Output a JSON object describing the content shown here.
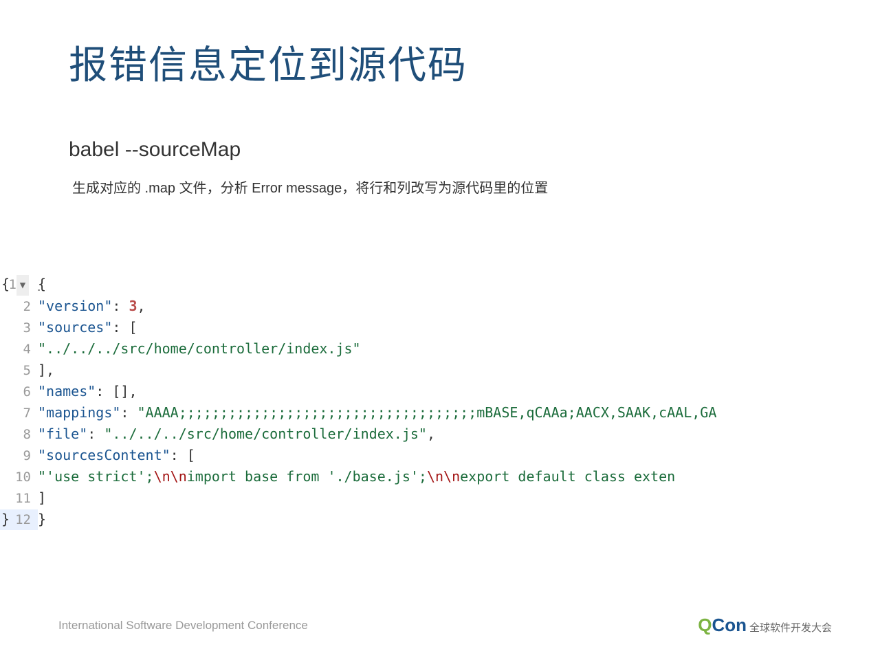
{
  "title": "报错信息定位到源代码",
  "subtitle": "babel --sourceMap",
  "description": "生成对应的 .map 文件，分析 Error message，将行和列改写为源代码里的位置",
  "code": {
    "lines": [
      {
        "num": "1",
        "fold": true
      },
      {
        "num": "2"
      },
      {
        "num": "3"
      },
      {
        "num": "4"
      },
      {
        "num": "5"
      },
      {
        "num": "6"
      },
      {
        "num": "7"
      },
      {
        "num": "8"
      },
      {
        "num": "9"
      },
      {
        "num": "10"
      },
      {
        "num": "11"
      },
      {
        "num": "12"
      }
    ],
    "keys": {
      "version": "\"version\"",
      "sources": "\"sources\"",
      "names": "\"names\"",
      "mappings": "\"mappings\"",
      "file": "\"file\"",
      "sourcesContent": "\"sourcesContent\""
    },
    "values": {
      "version": "3",
      "source0": "\"../../../src/home/controller/index.js\"",
      "mappings": "\"AAAA;;;;;;;;;;;;;;;;;;;;;;;;;;;;;;;;;;;;mBASE,qCAAa;AACX,SAAK,cAAL,GA",
      "file": "\"../../../src/home/controller/index.js\"",
      "sourcesContent0_prefix": "\"'use strict';",
      "sourcesContent0_esc1": "\\n\\n",
      "sourcesContent0_mid1": "import base from './base.js';",
      "sourcesContent0_esc2": "\\n\\n",
      "sourcesContent0_mid2": "export default class exten"
    }
  },
  "footer": {
    "left": "International Software Development Conference",
    "logo_q": "Q",
    "logo_con": "Con",
    "tag": "全球软件开发大会"
  }
}
